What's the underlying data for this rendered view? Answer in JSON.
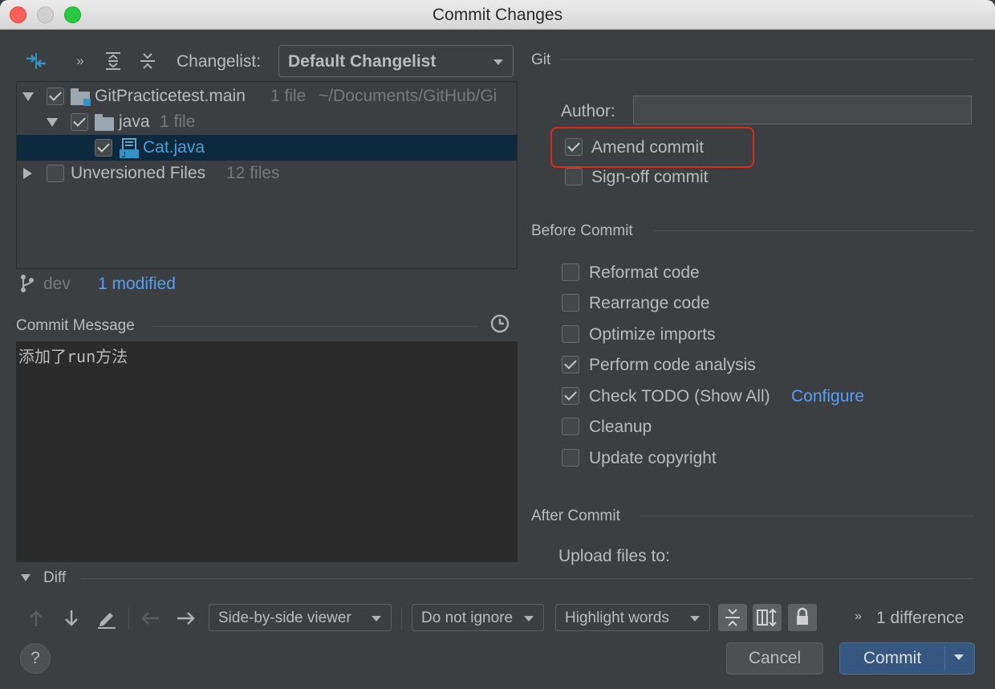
{
  "window": {
    "title": "Commit Changes"
  },
  "toolbar": {
    "changelist_label": "Changelist:",
    "changelist_value": "Default Changelist"
  },
  "tree": {
    "root": {
      "name": "GitPracticetest.main",
      "count": "1 file",
      "path": "~/Documents/GitHub/Gi"
    },
    "folder": {
      "name": "java",
      "count": "1 file"
    },
    "file": {
      "name": "Cat.java"
    },
    "unversioned": {
      "name": "Unversioned Files",
      "count": "12 files"
    }
  },
  "status": {
    "branch": "dev",
    "modified": "1 modified"
  },
  "commit_message": {
    "label": "Commit Message",
    "text": "添加了run方法"
  },
  "git": {
    "section": "Git",
    "author_label": "Author:",
    "author_value": "",
    "amend_commit": {
      "label": "Amend commit",
      "checked": true
    },
    "signoff_commit": {
      "label": "Sign-off commit",
      "checked": false
    }
  },
  "before_commit": {
    "section": "Before Commit",
    "options": [
      {
        "label": "Reformat code",
        "checked": false
      },
      {
        "label": "Rearrange code",
        "checked": false
      },
      {
        "label": "Optimize imports",
        "checked": false
      },
      {
        "label": "Perform code analysis",
        "checked": true
      },
      {
        "label": "Check TODO (Show All)",
        "checked": true,
        "link": "Configure"
      },
      {
        "label": "Cleanup",
        "checked": false
      },
      {
        "label": "Update copyright",
        "checked": false
      }
    ]
  },
  "after_commit": {
    "section": "After Commit",
    "upload_label": "Upload files to:"
  },
  "diff": {
    "label": "Diff",
    "viewer": "Side-by-side viewer",
    "ignore": "Do not ignore",
    "highlight": "Highlight words",
    "differences": "1 difference"
  },
  "buttons": {
    "help": "?",
    "cancel": "Cancel",
    "commit": "Commit"
  },
  "colors": {
    "accent": "#365880",
    "link": "#589df6",
    "highlight_box": "#e0261c"
  }
}
